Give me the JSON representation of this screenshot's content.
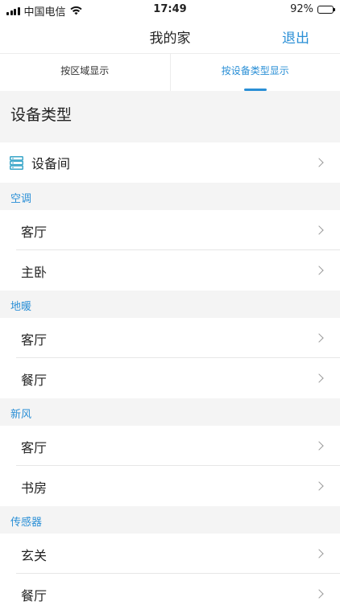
{
  "status_bar": {
    "carrier": "中国电信",
    "time": "17:49",
    "battery": "92%"
  },
  "navbar": {
    "title": "我的家",
    "logout": "退出"
  },
  "tabs": [
    {
      "label": "按区域显示",
      "active": false
    },
    {
      "label": "按设备类型显示",
      "active": true
    }
  ],
  "section_title": "设备类型",
  "device_room": {
    "label": "设备间",
    "icon": "server-stack-icon"
  },
  "groups": [
    {
      "name": "空调",
      "items": [
        "客厅",
        "主卧"
      ]
    },
    {
      "name": "地暖",
      "items": [
        "客厅",
        "餐厅"
      ]
    },
    {
      "name": "新风",
      "items": [
        "客厅",
        "书房"
      ]
    },
    {
      "name": "传感器",
      "items": [
        "玄关",
        "餐厅"
      ]
    }
  ],
  "colors": {
    "accent": "#2a8fd6",
    "background": "#f4f4f4",
    "divider": "#e6e6e6"
  }
}
